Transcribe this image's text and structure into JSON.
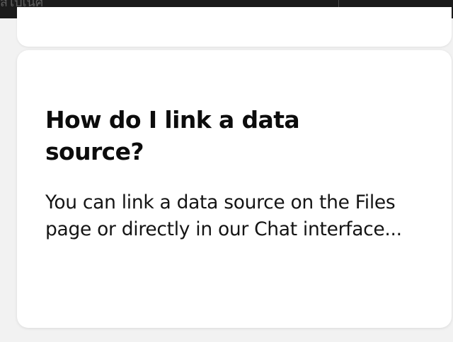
{
  "topbar": {
    "partial_text": "สไปเนิศ"
  },
  "faq": {
    "question": "How do I link a data source?",
    "answer": "You can link a data source on the Files page or directly in our Chat interface..."
  },
  "colors": {
    "topbar_bg": "#1b1b1b",
    "page_bg": "#f2f2f2",
    "card_bg": "#ffffff",
    "text": "#111111"
  }
}
